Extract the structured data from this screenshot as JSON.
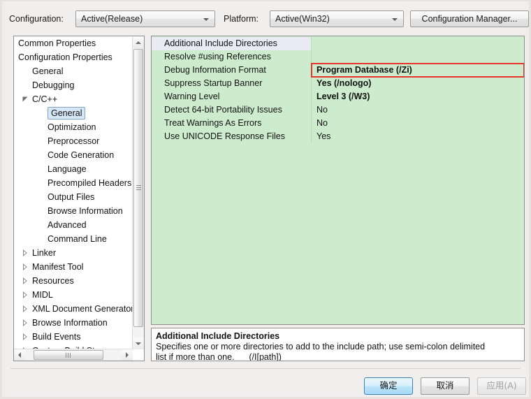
{
  "dialog": {
    "config_label": "Configuration:",
    "config_value": "Active(Release)",
    "platform_label": "Platform:",
    "platform_value": "Active(Win32)",
    "config_manager_button": "Configuration Manager...",
    "accent_red": "#e8342a",
    "grid_green": "#cdeccd",
    "selected_row_bg": "#eaeaf4"
  },
  "tree": {
    "nodes": [
      {
        "label": "Common Properties",
        "level": 0,
        "expander": "none",
        "selected": false
      },
      {
        "label": "Configuration Properties",
        "level": 0,
        "expander": "none",
        "selected": false
      },
      {
        "label": "General",
        "level": 1,
        "expander": "none",
        "selected": false
      },
      {
        "label": "Debugging",
        "level": 1,
        "expander": "none",
        "selected": false
      },
      {
        "label": "C/C++",
        "level": 1,
        "expander": "expanded",
        "selected": false
      },
      {
        "label": "General",
        "level": 2,
        "expander": "none",
        "selected": true
      },
      {
        "label": "Optimization",
        "level": 2,
        "expander": "none",
        "selected": false
      },
      {
        "label": "Preprocessor",
        "level": 2,
        "expander": "none",
        "selected": false
      },
      {
        "label": "Code Generation",
        "level": 2,
        "expander": "none",
        "selected": false
      },
      {
        "label": "Language",
        "level": 2,
        "expander": "none",
        "selected": false
      },
      {
        "label": "Precompiled Headers",
        "level": 2,
        "expander": "none",
        "selected": false
      },
      {
        "label": "Output Files",
        "level": 2,
        "expander": "none",
        "selected": false
      },
      {
        "label": "Browse Information",
        "level": 2,
        "expander": "none",
        "selected": false
      },
      {
        "label": "Advanced",
        "level": 2,
        "expander": "none",
        "selected": false
      },
      {
        "label": "Command Line",
        "level": 2,
        "expander": "none",
        "selected": false
      },
      {
        "label": "Linker",
        "level": 1,
        "expander": "collapsed",
        "selected": false
      },
      {
        "label": "Manifest Tool",
        "level": 1,
        "expander": "collapsed",
        "selected": false
      },
      {
        "label": "Resources",
        "level": 1,
        "expander": "collapsed",
        "selected": false
      },
      {
        "label": "MIDL",
        "level": 1,
        "expander": "collapsed",
        "selected": false
      },
      {
        "label": "XML Document Generator",
        "level": 1,
        "expander": "collapsed",
        "selected": false
      },
      {
        "label": "Browse Information",
        "level": 1,
        "expander": "collapsed",
        "selected": false
      },
      {
        "label": "Build Events",
        "level": 1,
        "expander": "collapsed",
        "selected": false
      },
      {
        "label": "Custom Build Step",
        "level": 1,
        "expander": "collapsed",
        "selected": false
      }
    ]
  },
  "grid": {
    "rows": [
      {
        "name": "Additional Include Directories",
        "value": "",
        "bold": false,
        "selected": true,
        "highlighted": false
      },
      {
        "name": "Resolve #using References",
        "value": "",
        "bold": false,
        "selected": false,
        "highlighted": false
      },
      {
        "name": "Debug Information Format",
        "value": "Program Database (/Zi)",
        "bold": true,
        "selected": false,
        "highlighted": true
      },
      {
        "name": "Suppress Startup Banner",
        "value": "Yes (/nologo)",
        "bold": true,
        "selected": false,
        "highlighted": false
      },
      {
        "name": "Warning Level",
        "value": "Level 3 (/W3)",
        "bold": true,
        "selected": false,
        "highlighted": false
      },
      {
        "name": "Detect 64-bit Portability Issues",
        "value": "No",
        "bold": false,
        "selected": false,
        "highlighted": false
      },
      {
        "name": "Treat Warnings As Errors",
        "value": "No",
        "bold": false,
        "selected": false,
        "highlighted": false
      },
      {
        "name": "Use UNICODE Response Files",
        "value": "Yes",
        "bold": false,
        "selected": false,
        "highlighted": false
      }
    ]
  },
  "description": {
    "title": "Additional Include Directories",
    "line1": "Specifies one or more directories to add to the include path; use semi-colon delimited",
    "line2": "list if more than one.      (/I[path])"
  },
  "buttons": {
    "ok": "确定",
    "cancel": "取消",
    "apply": "应用(A)"
  }
}
